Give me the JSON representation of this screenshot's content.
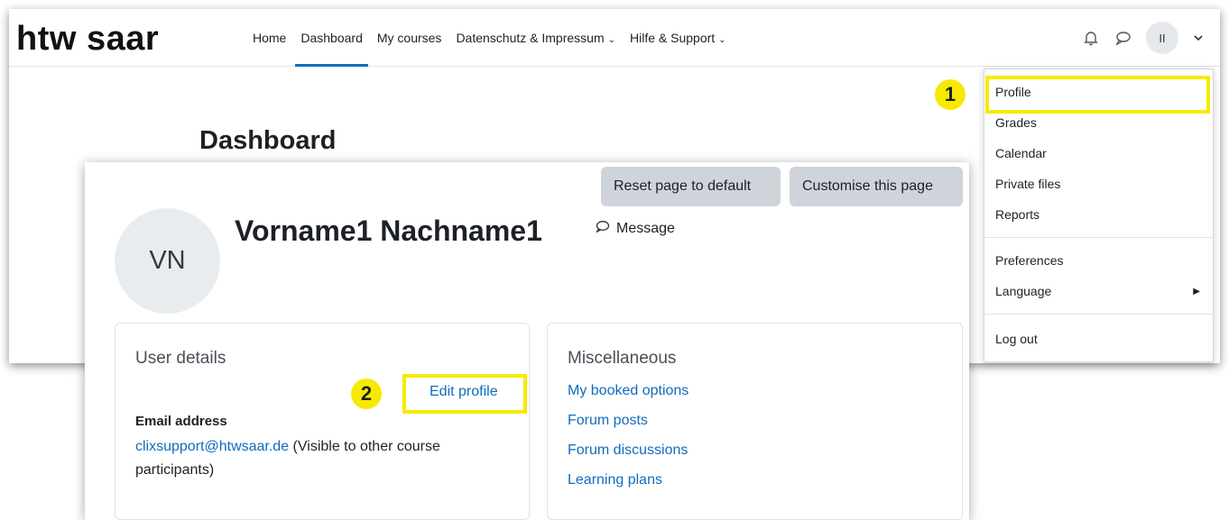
{
  "brand": "htw saar",
  "nav": {
    "items": [
      {
        "label": "Home"
      },
      {
        "label": "Dashboard",
        "active": true
      },
      {
        "label": "My courses"
      },
      {
        "label": "Datenschutz & Impressum",
        "dropdown": true
      },
      {
        "label": "Hilfe & Support",
        "dropdown": true
      }
    ],
    "avatar_initials": "II"
  },
  "page_title": "Dashboard",
  "user_menu": {
    "items": [
      "Profile",
      "Grades",
      "Calendar",
      "Private files",
      "Reports",
      "Preferences",
      "Language",
      "Log out"
    ]
  },
  "annotations": {
    "step1": "1",
    "step2": "2",
    "highlight_color": "#f7ea00"
  },
  "profile": {
    "reset_button": "Reset page to default",
    "customise_button": "Customise this page",
    "avatar_initials": "VN",
    "name": "Vorname1 Nachname1",
    "message_label": "Message",
    "user_details": {
      "title": "User details",
      "edit_link": "Edit profile",
      "email_label": "Email address",
      "email_value": "clixsupport@htwsaar.de",
      "email_note": " (Visible to other course participants)"
    },
    "misc": {
      "title": "Miscellaneous",
      "links": [
        "My booked options",
        "Forum posts",
        "Forum discussions",
        "Learning plans"
      ]
    }
  },
  "colors": {
    "link": "#0f6cbf",
    "active_underline": "#0f6cbf",
    "button_grey": "#ced4da"
  }
}
